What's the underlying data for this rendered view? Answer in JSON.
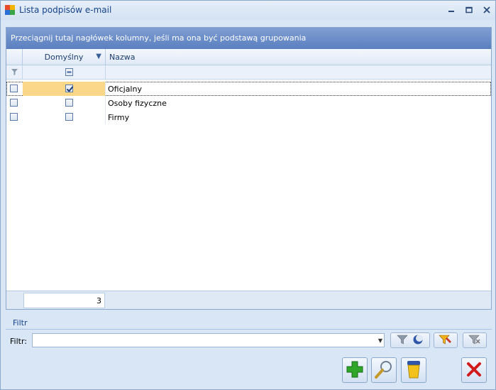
{
  "window": {
    "title": "Lista podpisów e-mail",
    "controls": [
      "minimize",
      "maximize",
      "close"
    ]
  },
  "grid": {
    "group_hint": "Przeciągnij tutaj nagłówek kolumny, jeśli ma ona być podstawą grupowania",
    "columns": {
      "default_label": "Domyślny",
      "name_label": "Nazwa"
    },
    "rows": [
      {
        "name": "Oficjalny",
        "selected_marker": false,
        "is_default": true,
        "selected": true
      },
      {
        "name": "Osoby fizyczne",
        "selected_marker": false,
        "is_default": false,
        "selected": false
      },
      {
        "name": "Firmy",
        "selected_marker": false,
        "is_default": false,
        "selected": false
      }
    ],
    "row_count": "3"
  },
  "filter": {
    "section_title": "Filtr",
    "label": "Filtr:",
    "value": ""
  },
  "icons": {
    "app": "app-grid-icon",
    "filter": "filter-icon",
    "clear_filter": "clear-filter-icon",
    "add": "plus-icon",
    "view": "magnifier-icon",
    "delete": "trash-icon",
    "close": "close-x-icon"
  },
  "colors": {
    "group_band": "#6d8fc9",
    "selected_cell": "#fbd889",
    "add_green": "#2fa52a",
    "close_red": "#d11a1a"
  }
}
